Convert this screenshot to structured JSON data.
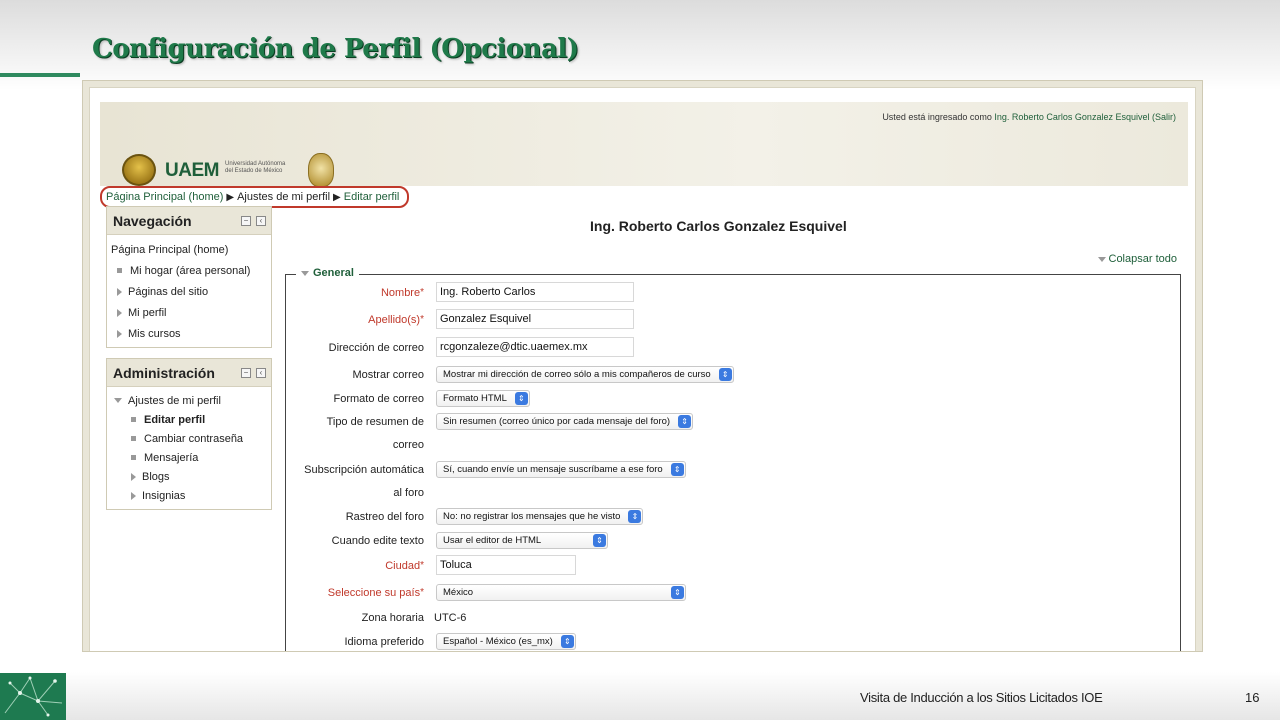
{
  "slide": {
    "title": "Configuración de Perfil (Opcional)",
    "footer": "Visita de Inducción a los Sitios Licitados IOE",
    "page_number": "16"
  },
  "header": {
    "login_prefix": "Usted está ingresado como",
    "user_name": "Ing. Roberto Carlos Gonzalez Esquivel",
    "logout": "(Salir)",
    "logo_text": "UAEM",
    "logo_sub": "Universidad Autónoma del Estado de México"
  },
  "breadcrumb": {
    "home": "Página Principal (home)",
    "sep": "▶",
    "settings": "Ajustes de mi perfil",
    "current": "Editar perfil"
  },
  "nav_block": {
    "title": "Navegación",
    "items": [
      "Página Principal (home)",
      "Mi hogar (área personal)",
      "Páginas del sitio",
      "Mi perfil",
      "Mis cursos"
    ]
  },
  "admin_block": {
    "title": "Administración",
    "items": [
      "Ajustes de mi perfil",
      "Editar perfil",
      "Cambiar contraseña",
      "Mensajería",
      "Blogs",
      "Insignias"
    ]
  },
  "main": {
    "heading": "Ing. Roberto Carlos Gonzalez Esquivel",
    "collapse_all": "Colapsar todo",
    "section": "General"
  },
  "form": {
    "nombre": {
      "label": "Nombre",
      "value": "Ing. Roberto Carlos"
    },
    "apellido": {
      "label": "Apellido(s)",
      "value": "Gonzalez Esquivel"
    },
    "email": {
      "label": "Dirección de correo",
      "value": "rcgonzaleze@dtic.uaemex.mx"
    },
    "show_email": {
      "label": "Mostrar correo",
      "value": "Mostrar mi dirección de correo sólo a mis compañeros de curso"
    },
    "email_format": {
      "label": "Formato de correo",
      "value": "Formato HTML"
    },
    "digest": {
      "label_1": "Tipo de resumen de",
      "label_2": "correo",
      "value": "Sin resumen (correo único por cada mensaje del foro)"
    },
    "autosub": {
      "label_1": "Subscripción automática",
      "label_2": "al foro",
      "value": "Sí, cuando envíe un mensaje suscríbame a ese foro"
    },
    "tracking": {
      "label": "Rastreo del foro",
      "value": "No: no registrar los mensajes que he visto"
    },
    "editor": {
      "label": "Cuando edite texto",
      "value": "Usar el editor de HTML"
    },
    "city": {
      "label": "Ciudad",
      "value": "Toluca"
    },
    "country": {
      "label": "Seleccione su país",
      "value": "México"
    },
    "timezone": {
      "label": "Zona horaria",
      "value": "UTC-6"
    },
    "language": {
      "label": "Idioma preferido",
      "value": "Español - México (es_mx)"
    }
  },
  "required_mark": "*",
  "colors": {
    "accent_green": "#1f5f3a",
    "required_red": "#c0392b",
    "select_blue": "#3b7ae0"
  }
}
